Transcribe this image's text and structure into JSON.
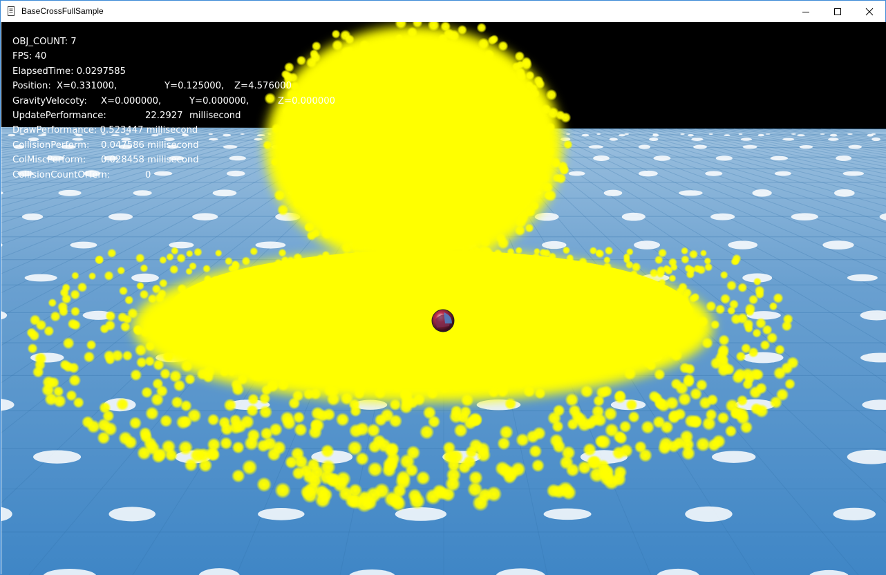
{
  "window": {
    "title": "BaseCrossFullSample",
    "icons": {
      "app": "document-icon",
      "minimize": "minimize-icon",
      "maximize": "maximize-icon",
      "close": "close-icon"
    }
  },
  "hud": {
    "obj_count": "OBJ_COUNT: 7",
    "fps": "FPS: 40",
    "elapsed_time": "ElapsedTime: 0.0297585",
    "position": {
      "label": "Position:",
      "x": "X=0.331000,",
      "y": "Y=0.125000,",
      "z": "Z=4.576000"
    },
    "gravity_velocity": {
      "label": "GravityVelocoty:",
      "x": "X=0.000000,",
      "y": "Y=0.000000,",
      "z": "Z=0.000000"
    },
    "update_performance": {
      "label": "UpdatePerformance:",
      "value": "22.2927",
      "unit": "millisecond"
    },
    "draw_performance": "DrawPerformance: 0.523447 millisecond",
    "collision_perform": {
      "label": "CollisionPerform:",
      "value": "0.047586 millisecond"
    },
    "col_misc_perform": {
      "label": "ColMiscPerform:",
      "value": "0.028458 millisecond"
    },
    "collision_count": {
      "label": "CollisionCountOfTern:",
      "value": "0"
    }
  },
  "scene": {
    "sky_color": "#000000",
    "floor_color": "#5b93c8",
    "particle_color": "#ffff00",
    "player": "player-ball"
  }
}
